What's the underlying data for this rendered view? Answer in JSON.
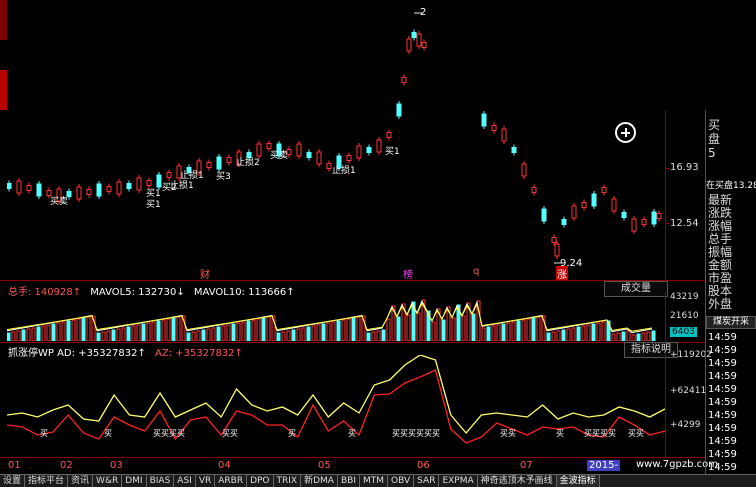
{
  "top_right_markers": "2",
  "price_panel": {
    "labels": {
      "axis_ticks": [
        "16.93",
        "12.54"
      ],
      "max_label": "2",
      "min_label": "9.24",
      "bottom_marks": [
        "财",
        "榜",
        "q",
        "涨"
      ],
      "signals": [
        {
          "text": "买卖",
          "color": "#ffffff"
        },
        {
          "text": "买1",
          "color": "#ffffff"
        },
        {
          "text": "止损1",
          "color": "#ffffff"
        },
        {
          "text": "买2",
          "color": "#ffffff"
        },
        {
          "text": "止损1",
          "color": "#ffffff"
        },
        {
          "text": "买3",
          "color": "#ffffff"
        },
        {
          "text": "止损2",
          "color": "#ffffff"
        },
        {
          "text": "买卖",
          "color": "#ffffff"
        },
        {
          "text": "买1",
          "color": "#ffffff"
        },
        {
          "text": "买1",
          "color": "#ffffff"
        },
        {
          "text": "止损1",
          "color": "#ffffff"
        }
      ]
    }
  },
  "volume_panel": {
    "title_prefix": "总手: 140928↑",
    "mavol5": "MAVOL5: 132730↓",
    "mavol10": "MAVOL10: 113666↑",
    "dropdown_label": "成交量",
    "ticks": [
      "43219",
      "21610",
      "6403"
    ]
  },
  "indicator_panel": {
    "title": "抓涨停WP AD: +35327832↑",
    "az": "AZ: +35327832↑",
    "help_button": "指标说明",
    "ticks": [
      "+119202",
      "+62411",
      "+4299"
    ],
    "bottom_signals": [
      "买",
      "买",
      "买买买买",
      "买买",
      "买",
      "买",
      "买买买买买买",
      "买买",
      "买",
      "买买买买",
      "买买"
    ]
  },
  "months": [
    "01",
    "02",
    "03",
    "04",
    "05",
    "06",
    "07",
    "2015-"
  ],
  "side_panel": {
    "items": [
      "买",
      "盘",
      "5",
      "在买盘",
      "13.28",
      "最新",
      "涨跌",
      "涨幅",
      "总手",
      "振幅",
      "金额",
      "市盈",
      "股本",
      "外盘"
    ],
    "bottom_button": "煤炭开采",
    "times": [
      "14:59",
      "14:59",
      "14:59",
      "14:59",
      "14:59",
      "14:59",
      "14:59",
      "14:59",
      "14:59",
      "14:59",
      "14:59"
    ]
  },
  "bottom_tabs": [
    "设置",
    "指标平台",
    "资讯",
    "W&R",
    "DMI",
    "BIAS",
    "ASI",
    "VR",
    "ARBR",
    "DPO",
    "TRIX",
    "新DMA",
    "BBI",
    "MTM",
    "OBV",
    "SAR",
    "EXPMA",
    "神奇逃顶木予画线",
    "金波指标"
  ],
  "watermark": "www.7gpzb.com"
}
